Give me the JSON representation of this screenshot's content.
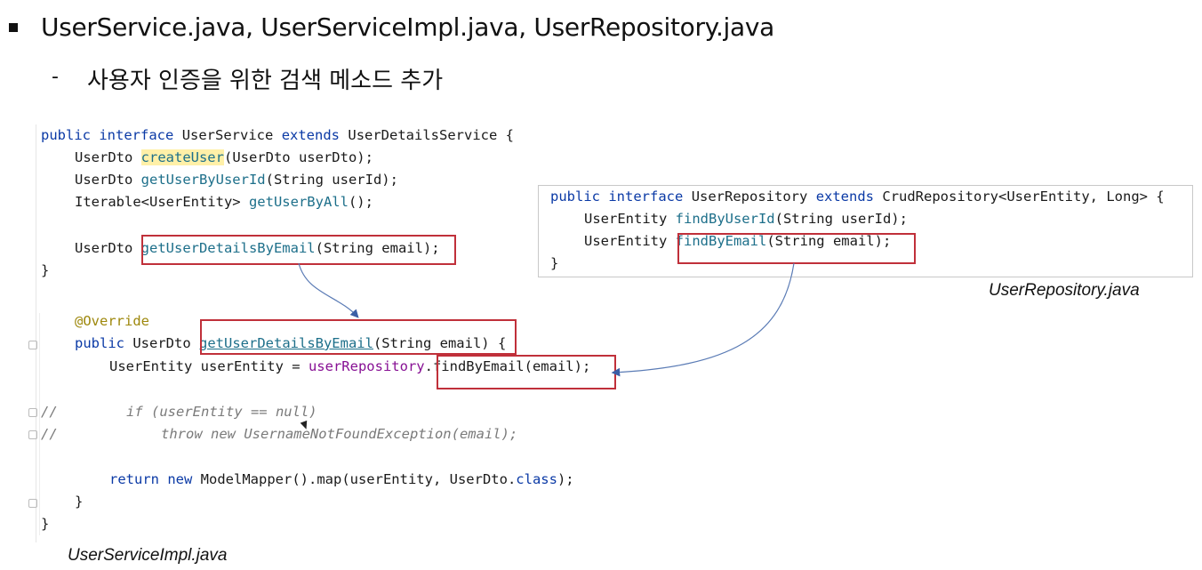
{
  "slide": {
    "title": "UserService.java, UserServiceImpl.java, UserRepository.java",
    "subtitle_dash": "-",
    "subtitle": "사용자 인증을 위한  검색 메소드 추가"
  },
  "user_service": {
    "l1_kw1": "public",
    "l1_kw2": "interface",
    "l1_name": "UserService",
    "l1_kw3": "extends",
    "l1_rest": "UserDetailsService {",
    "l2_type": "UserDto ",
    "l2_fn": "createUser",
    "l2_rest": "(UserDto userDto);",
    "l3_type": "UserDto ",
    "l3_fn": "getUserByUserId",
    "l3_rest": "(String userId);",
    "l4_type": "Iterable<UserEntity> ",
    "l4_fn": "getUserByAll",
    "l4_rest": "();",
    "l5_type": "UserDto ",
    "l5_fn": "getUserDetailsByEmail",
    "l5_rest": "(String email);",
    "close": "}"
  },
  "user_repository": {
    "l1_kw1": "public",
    "l1_kw2": "interface",
    "l1_name": "UserRepository",
    "l1_kw3": "extends",
    "l1_rest": "CrudRepository<UserEntity, Long> {",
    "l2_type": "UserEntity ",
    "l2_fn": "findByUserId",
    "l2_rest": "(String userId);",
    "l3_type": "UserEntity ",
    "l3_fn": "findByEmail",
    "l3_rest": "(String email);",
    "close": "}",
    "caption": "UserRepository.java"
  },
  "user_service_impl": {
    "annotation": "@Override",
    "l2_kw": "public",
    "l2_type": " UserDto ",
    "l2_fn": "getUserDetailsByEmail",
    "l2_rest": "(String email) {",
    "l3_type": "UserEntity userEntity = ",
    "l3_field": "userRepository",
    "l3_dot": ".",
    "l3_call": "findByEmail(email);",
    "c1_prefix": "//",
    "c1_text": "if (userEntity == null)",
    "c2_prefix": "//",
    "c2_text": "throw new UsernameNotFoundException(email);",
    "l6_kw1": "return",
    "l6_kw2": "new",
    "l6_rest": " ModelMapper().map(userEntity, UserDto.",
    "l6_kw3": "class",
    "l6_end": ");",
    "inner_close": "}",
    "outer_close": "}",
    "caption": "UserServiceImpl.java"
  },
  "colors": {
    "keyword": "#0b3aa6",
    "method": "#1d6f8a",
    "annotation": "#9e880d",
    "field": "#871094",
    "comment": "#7a7a7a",
    "highlight_box": "#c0303a",
    "arrow": "#5a7bb5"
  }
}
